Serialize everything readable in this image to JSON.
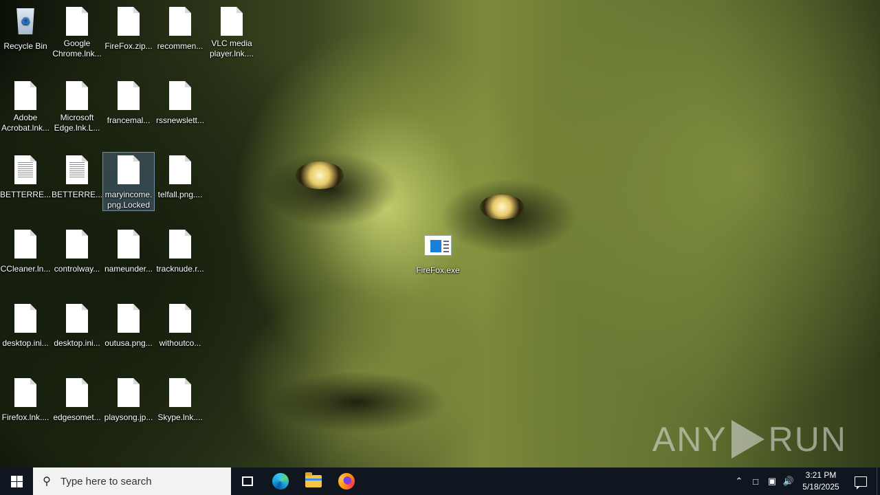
{
  "desktop": {
    "icons": [
      {
        "label": "Recycle Bin",
        "kind": "recycle-bin"
      },
      {
        "label": "Google Chrome.lnk...",
        "kind": "file"
      },
      {
        "label": "FireFox.zip...",
        "kind": "file"
      },
      {
        "label": "recommen...",
        "kind": "file"
      },
      {
        "label": "VLC media player.lnk....",
        "kind": "file"
      },
      {
        "label": "Adobe Acrobat.lnk...",
        "kind": "file"
      },
      {
        "label": "Microsoft Edge.lnk.L...",
        "kind": "file"
      },
      {
        "label": "francemal...",
        "kind": "file"
      },
      {
        "label": "rssnewslett...",
        "kind": "file"
      },
      {
        "label": "BETTERRE...",
        "kind": "text-file"
      },
      {
        "label": "BETTERRE...",
        "kind": "text-file"
      },
      {
        "label": "maryincome.png.Locked",
        "kind": "file",
        "selected": true
      },
      {
        "label": "telfall.png....",
        "kind": "file"
      },
      {
        "label": "CCleaner.ln...",
        "kind": "file"
      },
      {
        "label": "controlway...",
        "kind": "file"
      },
      {
        "label": "nameunder...",
        "kind": "file"
      },
      {
        "label": "tracknude.r...",
        "kind": "file"
      },
      {
        "label": "desktop.ini...",
        "kind": "file"
      },
      {
        "label": "desktop.ini...",
        "kind": "file"
      },
      {
        "label": "outusa.png...",
        "kind": "file"
      },
      {
        "label": "withoutco...",
        "kind": "file"
      },
      {
        "label": "Firefox.lnk....",
        "kind": "file"
      },
      {
        "label": "edgesomet...",
        "kind": "file"
      },
      {
        "label": "playsong.jp...",
        "kind": "file"
      },
      {
        "label": "Skype.lnk....",
        "kind": "file"
      },
      {
        "label": "FireFox.exe",
        "kind": "exe"
      }
    ],
    "watermark": {
      "left": "ANY",
      "right": "RUN"
    }
  },
  "taskbar": {
    "search_placeholder": "Type here to search",
    "pinned": [
      "Task View",
      "Microsoft Edge",
      "File Explorer",
      "Firefox"
    ],
    "clock_time": "3:21 PM",
    "clock_date": "5/18/2025",
    "background_color": "#0f1620"
  }
}
